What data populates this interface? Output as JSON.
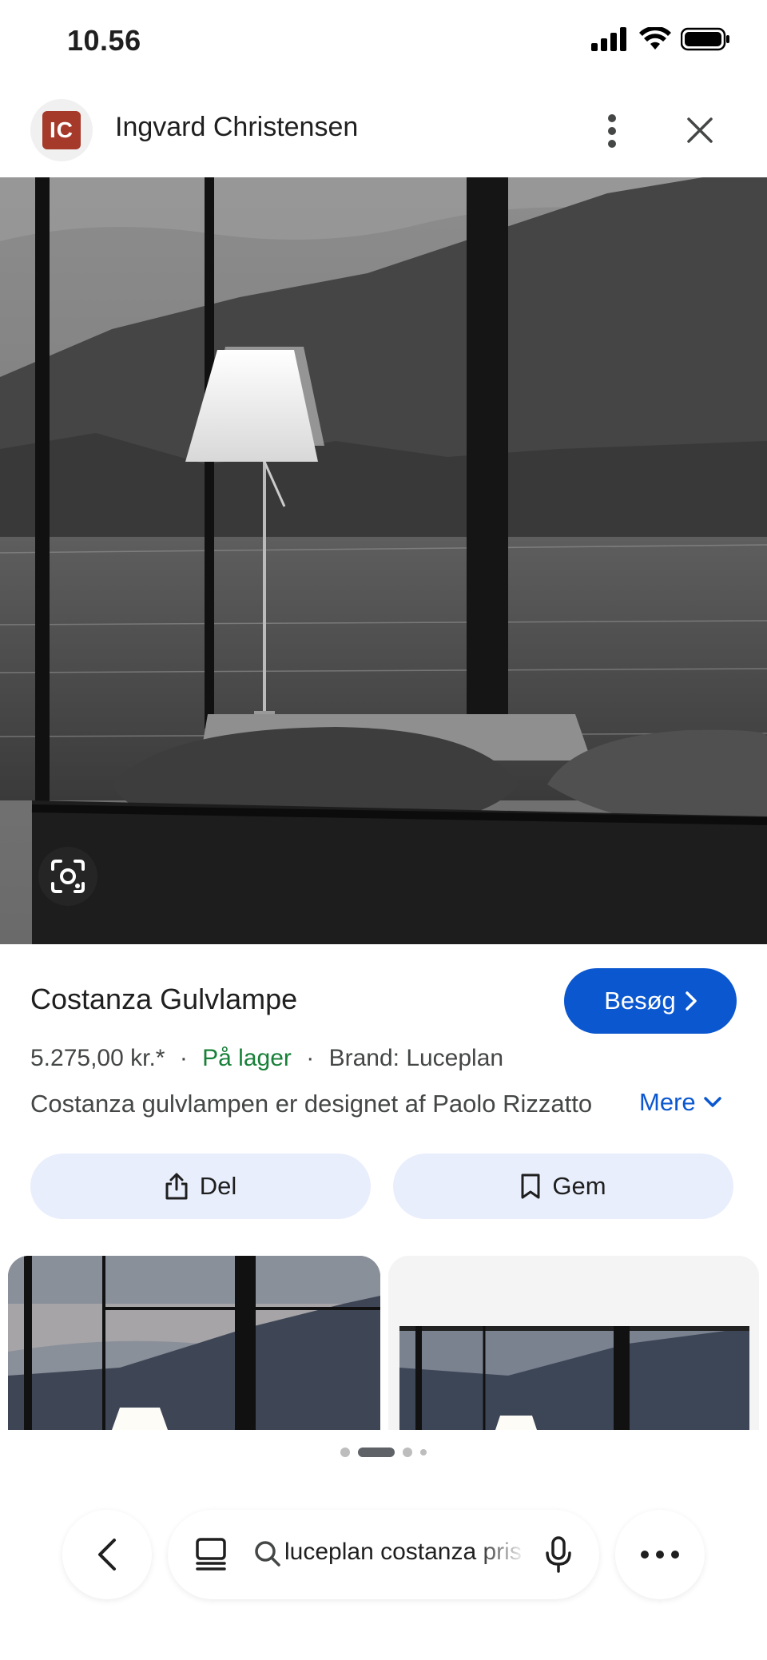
{
  "status_bar": {
    "time": "10.56"
  },
  "header": {
    "avatar_initials": "IC",
    "account_name": "Ingvard Christensen",
    "more_icon": "more-vert-icon",
    "close_icon": "close-icon"
  },
  "hero_image": {
    "description_icon": "lens-icon"
  },
  "product": {
    "title": "Costanza Gulvlampe",
    "visit_label": "Besøg",
    "price": "5.275,00 kr.*",
    "separator": "·",
    "stock": "På lager",
    "brand": "Brand: Luceplan",
    "description": "Costanza gulvlampen er designet af Paolo Rizzatto",
    "more_label": "Mere"
  },
  "actions": {
    "share_label": "Del",
    "save_label": "Gem"
  },
  "pager": {
    "active_index": 1,
    "count": 4
  },
  "bottom_bar": {
    "search_query": "luceplan costanza pris"
  },
  "colors": {
    "accent": "#0b57d0",
    "in_stock": "#188038",
    "action_bg": "#e8eefc",
    "avatar_bg": "#a63a2a"
  }
}
